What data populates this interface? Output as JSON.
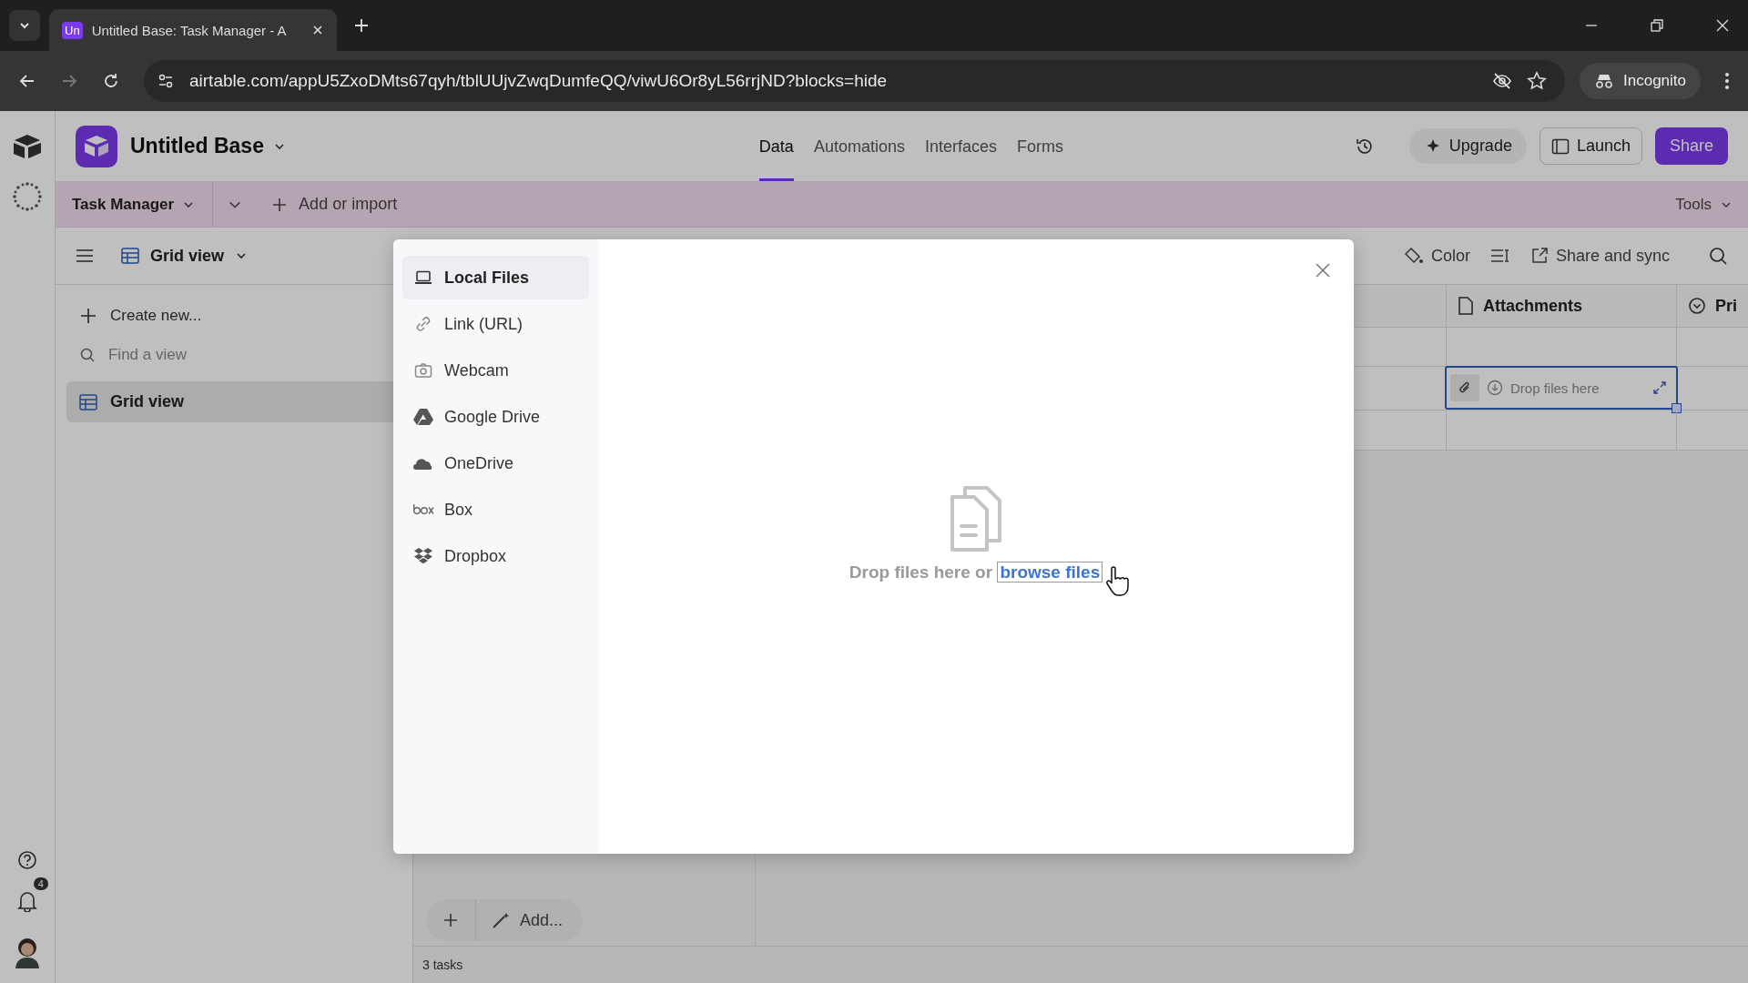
{
  "browser": {
    "tab": {
      "favicon": "Un",
      "title": "Untitled Base: Task Manager - A"
    },
    "url": "airtable.com/appU5ZxoDMts67qyh/tblUUjvZwqDumfeQQ/viwU6Or8yL56rrjND?blocks=hide",
    "profile": "Incognito"
  },
  "header": {
    "base_name": "Untitled Base",
    "tabs": [
      {
        "label": "Data",
        "selected": true
      },
      {
        "label": "Automations",
        "selected": false
      },
      {
        "label": "Interfaces",
        "selected": false
      },
      {
        "label": "Forms",
        "selected": false
      }
    ],
    "upgrade": "Upgrade",
    "launch": "Launch",
    "share": "Share"
  },
  "notifications": {
    "count": "4"
  },
  "table_bar": {
    "table": "Task Manager",
    "add": "Add or import",
    "tools": "Tools"
  },
  "view_bar": {
    "view": "Grid view",
    "actions": [
      {
        "label": "Color",
        "kind": "color"
      },
      {
        "label": "Share and sync",
        "kind": "share"
      }
    ]
  },
  "sidebar": {
    "create": "Create new...",
    "search_placeholder": "Find a view",
    "views": [
      {
        "label": "Grid view",
        "selected": true
      }
    ]
  },
  "grid": {
    "columns": [
      {
        "label": "Attachments",
        "kind": "attachment"
      },
      {
        "label": "Pri",
        "kind": "select"
      }
    ],
    "rows": [
      {
        "selected": false
      },
      {
        "selected": true
      },
      {
        "selected": false
      }
    ],
    "drop_hint": "Drop files here"
  },
  "footer": {
    "add": "Add...",
    "count": "3 tasks"
  },
  "upload_dialog": {
    "sources": [
      {
        "label": "Local Files",
        "kind": "local",
        "selected": true
      },
      {
        "label": "Link (URL)",
        "kind": "link",
        "selected": false
      },
      {
        "label": "Webcam",
        "kind": "webcam",
        "selected": false
      },
      {
        "label": "Google Drive",
        "kind": "gdrive",
        "selected": false
      },
      {
        "label": "OneDrive",
        "kind": "onedrive",
        "selected": false
      },
      {
        "label": "Box",
        "kind": "box",
        "selected": false
      },
      {
        "label": "Dropbox",
        "kind": "dropbox",
        "selected": false
      }
    ],
    "prompt": "Drop files here or",
    "link": "browse files"
  }
}
